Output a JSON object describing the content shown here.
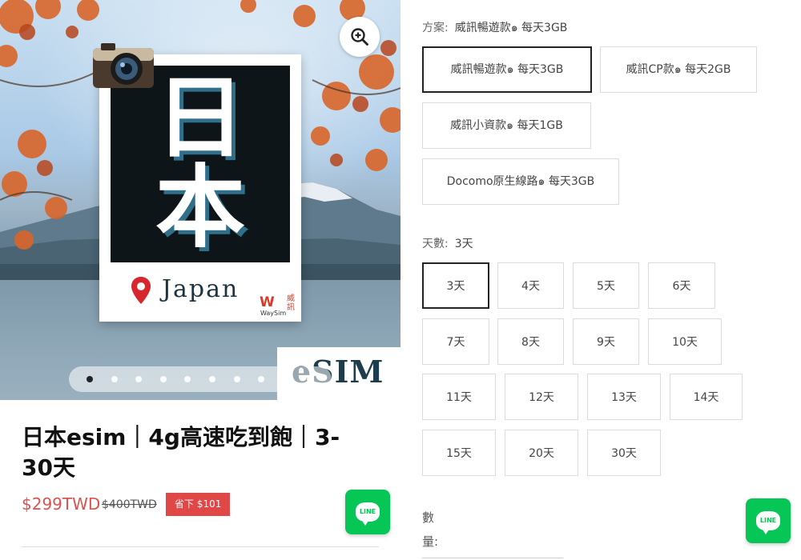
{
  "image": {
    "kanji_line1": "日",
    "kanji_line2": "本",
    "country_label": "Japan",
    "brand_logo_letter": "W",
    "brand_logo_zh": "威訊",
    "brand_logo_name": "WaySim",
    "badge_text": "eSIM",
    "slide_count": 10,
    "active_slide": 1
  },
  "product": {
    "title": "日本esim｜4g高速吃到飽｜3-30天",
    "price_current": "$299TWD",
    "price_original": "$400TWD",
    "save_badge": "省下 $101"
  },
  "line_button": {
    "label": "LINE"
  },
  "plan": {
    "label": "方案:",
    "selected": "威訊暢遊款๑ 每天3GB",
    "options": [
      {
        "label": "威訊暢遊款๑ 每天3GB",
        "selected": true
      },
      {
        "label": "威訊CP款๑ 每天2GB",
        "selected": false
      },
      {
        "label": "威訊小資款๑ 每天1GB",
        "selected": false
      },
      {
        "label": "Docomo原生線路๑ 每天3GB",
        "selected": false
      }
    ]
  },
  "days": {
    "label": "天數:",
    "selected": "3天",
    "options": [
      {
        "label": "3天",
        "selected": true
      },
      {
        "label": "4天",
        "selected": false
      },
      {
        "label": "5天",
        "selected": false
      },
      {
        "label": "6天",
        "selected": false
      },
      {
        "label": "7天",
        "selected": false
      },
      {
        "label": "8天",
        "selected": false
      },
      {
        "label": "9天",
        "selected": false
      },
      {
        "label": "10天",
        "selected": false
      },
      {
        "label": "11天",
        "selected": false
      },
      {
        "label": "12天",
        "selected": false
      },
      {
        "label": "13天",
        "selected": false
      },
      {
        "label": "14天",
        "selected": false
      },
      {
        "label": "15天",
        "selected": false
      },
      {
        "label": "20天",
        "selected": false
      },
      {
        "label": "30天",
        "selected": false
      }
    ]
  },
  "quantity": {
    "label": "數量:"
  },
  "colors": {
    "accent_price": "#d9534f",
    "save_badge_bg": "#e04848",
    "line_green": "#06c755",
    "selected_border": "#222222"
  }
}
